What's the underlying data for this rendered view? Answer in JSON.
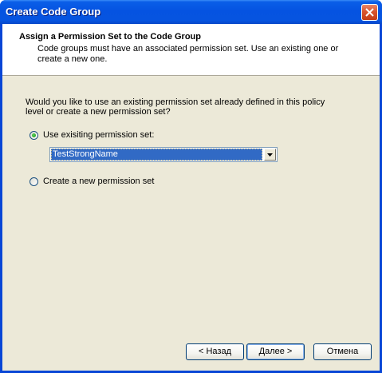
{
  "window": {
    "title": "Create Code Group"
  },
  "header": {
    "title": "Assign a Permission Set to the Code Group",
    "subtitle": "Code groups must have an associated permission set. Use an existing one or create a new one."
  },
  "body": {
    "question": "Would you like to use an existing permission set already defined in this policy level or create a new permission set?",
    "option_existing": {
      "label": "Use exisiting permission set:",
      "selected": true
    },
    "permission_set_select": {
      "value": "TestStrongName"
    },
    "option_new": {
      "label": "Create a new permission set",
      "selected": false
    }
  },
  "buttons": {
    "back": "< Назад",
    "next": "Далее >",
    "cancel": "Отмена"
  },
  "colors": {
    "titlebar": "#0553e1",
    "dialog_bg": "#ece9d8",
    "selection": "#316ac5",
    "close_button": "#d9542e"
  },
  "icons": {
    "close": "close-icon",
    "dropdown": "chevron-down-icon"
  }
}
